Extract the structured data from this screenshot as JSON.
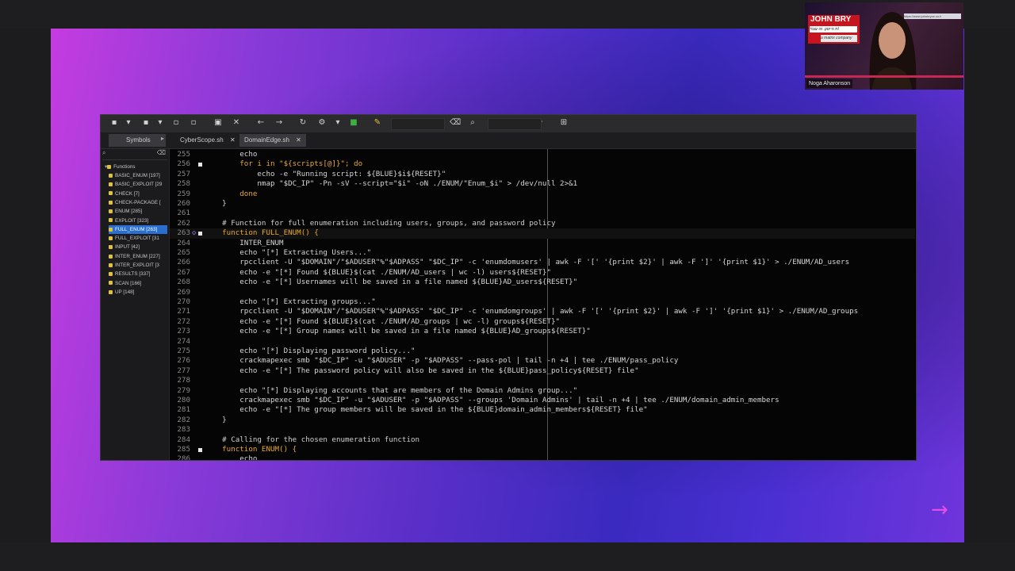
{
  "webcam": {
    "banner_title": "JOHN BRY",
    "banner_subtitle": "ת הייטק. זה עובד!",
    "banner_brand": "a matrix company",
    "url_text": "https://www.johnbryce.co.il",
    "participant_name": "Noga Aharonson"
  },
  "toolbar": {
    "icons": [
      "new-file-icon",
      "dropdown-icon",
      "save-icon",
      "dropdown-icon",
      "save-all-icon",
      "close-all-icon",
      "revert-icon",
      "close-icon",
      "back-icon",
      "forward-icon",
      "reload-icon",
      "settings-icon",
      "dropdown-icon",
      "run-icon",
      "color-picker-icon",
      "clear-icon",
      "search-icon",
      "clear-icon",
      "jump-icon",
      "preferences-icon"
    ]
  },
  "sidebar": {
    "tab_label": "Symbols",
    "root_label": "Functions",
    "items": [
      {
        "label": "BASIC_ENUM [197]",
        "selected": false
      },
      {
        "label": "BASIC_EXPLOIT [29",
        "selected": false
      },
      {
        "label": "CHECK [7]",
        "selected": false
      },
      {
        "label": "CHECK-PACKAGE [",
        "selected": false
      },
      {
        "label": "ENUM [285]",
        "selected": false
      },
      {
        "label": "EXPLOIT [323]",
        "selected": false
      },
      {
        "label": "FULL_ENUM [263]",
        "selected": true
      },
      {
        "label": "FULL_EXPLOIT [31",
        "selected": false
      },
      {
        "label": "INPUT [42]",
        "selected": false
      },
      {
        "label": "INTER_ENUM [227]",
        "selected": false
      },
      {
        "label": "INTER_EXPLOIT [3",
        "selected": false
      },
      {
        "label": "RESULTS [337]",
        "selected": false
      },
      {
        "label": "SCAN [166]",
        "selected": false
      },
      {
        "label": "UP [148]",
        "selected": false
      }
    ]
  },
  "tabs": [
    {
      "label": "CyberScope.sh",
      "active": false
    },
    {
      "label": "DomainEdge.sh",
      "active": true
    }
  ],
  "editor": {
    "current_line": "263",
    "lines": [
      {
        "n": "255",
        "text": "        echo"
      },
      {
        "n": "256",
        "text": "        for i in \"${scripts[@]}\"; do"
      },
      {
        "n": "257",
        "text": "            echo -e \"Running script: ${BLUE}$i${RESET}\""
      },
      {
        "n": "258",
        "text": "            nmap \"$DC_IP\" -Pn -sV --script=\"$i\" -oN ./ENUM/\"Enum_$i\" > /dev/null 2>&1"
      },
      {
        "n": "259",
        "text": "        done"
      },
      {
        "n": "260",
        "text": "    }"
      },
      {
        "n": "261",
        "text": ""
      },
      {
        "n": "262",
        "text": "    # Function for full enumeration including users, groups, and password policy"
      },
      {
        "n": "263",
        "text": "    function FULL_ENUM() {"
      },
      {
        "n": "264",
        "text": "        INTER_ENUM"
      },
      {
        "n": "265",
        "text": "        echo \"[*] Extracting Users...\""
      },
      {
        "n": "266",
        "text": "        rpcclient -U \"$DOMAIN\"/\"$ADUSER\"%\"$ADPASS\" \"$DC_IP\" -c 'enumdomusers' | awk -F '[' '{print $2}' | awk -F ']' '{print $1}' > ./ENUM/AD_users"
      },
      {
        "n": "267",
        "text": "        echo -e \"[*] Found ${BLUE}$(cat ./ENUM/AD_users | wc -l) users${RESET}\""
      },
      {
        "n": "268",
        "text": "        echo -e \"[*] Usernames will be saved in a file named ${BLUE}AD_users${RESET}\""
      },
      {
        "n": "269",
        "text": ""
      },
      {
        "n": "270",
        "text": "        echo \"[*] Extracting groups...\""
      },
      {
        "n": "271",
        "text": "        rpcclient -U \"$DOMAIN\"/\"$ADUSER\"%\"$ADPASS\" \"$DC_IP\" -c 'enumdomgroups' | awk -F '[' '{print $2}' | awk -F ']' '{print $1}' > ./ENUM/AD_groups"
      },
      {
        "n": "272",
        "text": "        echo -e \"[*] Found ${BLUE}$(cat ./ENUM/AD_groups | wc -l) groups${RESET}\""
      },
      {
        "n": "273",
        "text": "        echo -e \"[*] Group names will be saved in a file named ${BLUE}AD_groups${RESET}\""
      },
      {
        "n": "274",
        "text": ""
      },
      {
        "n": "275",
        "text": "        echo \"[*] Displaying password policy...\""
      },
      {
        "n": "276",
        "text": "        crackmapexec smb \"$DC_IP\" -u \"$ADUSER\" -p \"$ADPASS\" --pass-pol | tail -n +4 | tee ./ENUM/pass_policy"
      },
      {
        "n": "277",
        "text": "        echo -e \"[*] The password policy will also be saved in the ${BLUE}pass_policy${RESET} file\""
      },
      {
        "n": "278",
        "text": ""
      },
      {
        "n": "279",
        "text": "        echo \"[*] Displaying accounts that are members of the Domain Admins group...\""
      },
      {
        "n": "280",
        "text": "        crackmapexec smb \"$DC_IP\" -u \"$ADUSER\" -p \"$ADPASS\" --groups 'Domain Admins' | tail -n +4 | tee ./ENUM/domain_admin_members"
      },
      {
        "n": "281",
        "text": "        echo -e \"[*] The group members will be saved in the ${BLUE}domain_admin_members${RESET} file\""
      },
      {
        "n": "282",
        "text": "    }"
      },
      {
        "n": "283",
        "text": ""
      },
      {
        "n": "284",
        "text": "    # Calling for the chosen enumeration function"
      },
      {
        "n": "285",
        "text": "    function ENUM() {"
      },
      {
        "n": "286",
        "text": "        echo"
      }
    ]
  },
  "colors": {
    "keyword": "#e8a830",
    "string": "#e8e8e8",
    "comment": "#cfcfcf",
    "selection": "#2a6fd0",
    "accent_arrow": "#e050e8"
  },
  "slide": {
    "next_arrow": "→"
  }
}
